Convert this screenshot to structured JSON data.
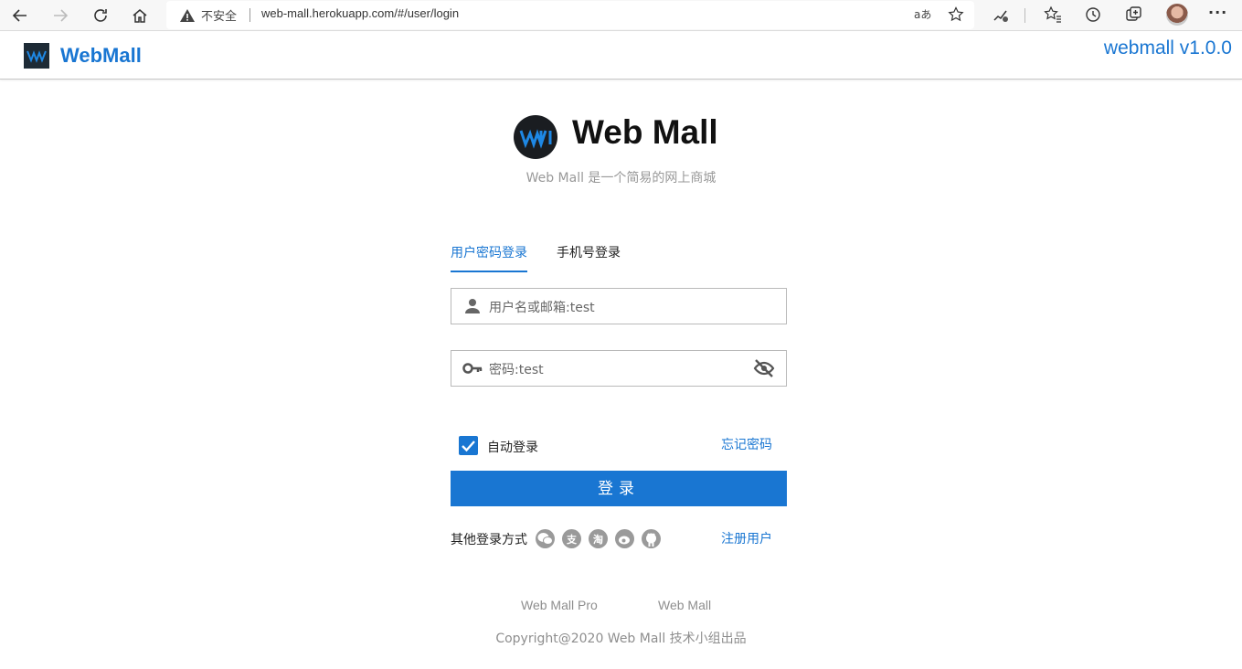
{
  "browser": {
    "insecure_label": "不安全",
    "url": "web-mall.herokuapp.com/#/user/login",
    "read_aloud": "aあ"
  },
  "header": {
    "app_name": "WebMall",
    "version": "webmall v1.0.0"
  },
  "hero": {
    "title": "Web Mall",
    "subtitle": "Web Mall 是一个简易的网上商城"
  },
  "tabs": [
    {
      "label": "用户密码登录",
      "active": true
    },
    {
      "label": "手机号登录",
      "active": false
    }
  ],
  "form": {
    "username_placeholder": "用户名或邮箱:test",
    "password_placeholder": "密码:test",
    "auto_login_label": "自动登录",
    "auto_login_checked": true,
    "forgot_label": "忘记密码",
    "submit_label": "登录",
    "other_login_label": "其他登录方式",
    "register_label": "注册用户"
  },
  "social_icons": [
    "wechat-icon",
    "alipay-icon",
    "taobao-icon",
    "weibo-icon",
    "github-icon"
  ],
  "footer": {
    "links": [
      "Web Mall Pro",
      "Web Mall"
    ],
    "copyright": "Copyright@2020 Web Mall 技术小组出品"
  },
  "colors": {
    "primary": "#1976d2",
    "muted": "#8e8e8e"
  }
}
